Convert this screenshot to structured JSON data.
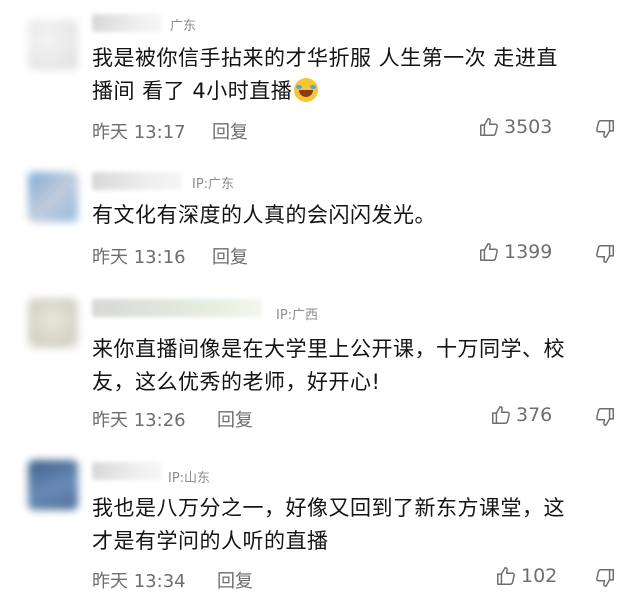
{
  "comments": [
    {
      "ip": "广东",
      "text_lines": [
        "我是被你信手拈来的才华折服 人生第一次 走进直",
        "播间 看了 4小时直播"
      ],
      "time": "昨天 13:17",
      "reply": "回复",
      "likes": "3503"
    },
    {
      "ip": "IP:广东",
      "text_lines": [
        "有文化有深度的人真的会闪闪发光。"
      ],
      "time": "昨天 13:16",
      "reply": "回复",
      "likes": "1399"
    },
    {
      "ip": "IP:广西",
      "text_lines": [
        "来你直播间像是在大学里上公开课，十万同学、校",
        "友，这么优秀的老师，好开心!"
      ],
      "time": "昨天 13:26",
      "reply": "回复",
      "likes": "376"
    },
    {
      "ip": "IP:山东",
      "text_lines": [
        "我也是八万分之一，好像又回到了新东方课堂，这",
        "才是有学问的人听的直播"
      ],
      "time": "昨天 13:34",
      "reply": "回复",
      "likes": "102"
    }
  ],
  "icons": {
    "like": "thumbs-up-icon",
    "dislike": "thumbs-down-icon",
    "emoji": "laughing-tears-emoji-icon"
  }
}
